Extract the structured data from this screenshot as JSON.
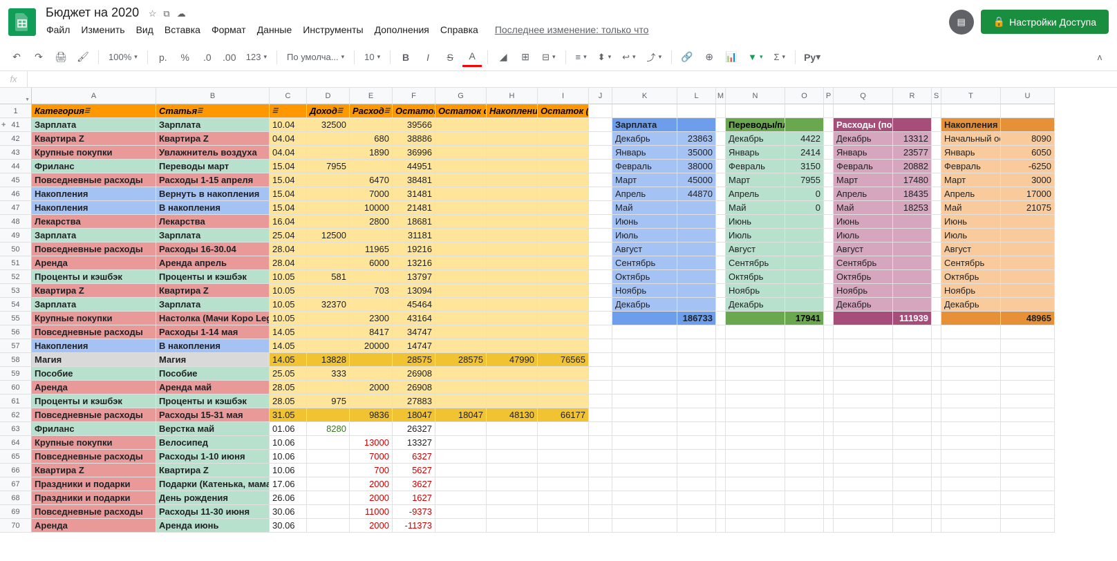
{
  "doc": {
    "title": "Бюджет на 2020"
  },
  "menus": {
    "file": "Файл",
    "edit": "Изменить",
    "view": "Вид",
    "insert": "Вставка",
    "format": "Формат",
    "data": "Данные",
    "tools": "Инструменты",
    "addons": "Дополнения",
    "help": "Справка",
    "lastedit": "Последнее изменение: только что"
  },
  "share": "Настройки Доступа",
  "toolbar": {
    "zoom": "100%",
    "currency": "р.",
    "percent": "%",
    "dec0": ".0",
    "dec00": ".00",
    "num": "123",
    "font": "По умолча...",
    "size": "10"
  },
  "cols": [
    "A",
    "B",
    "C",
    "D",
    "E",
    "F",
    "G",
    "H",
    "I",
    "J",
    "K",
    "L",
    "M",
    "N",
    "O",
    "P",
    "Q",
    "R",
    "S",
    "T",
    "U"
  ],
  "headers": {
    "A": "Категория",
    "B": "Статья",
    "C": "",
    "D": "Доход",
    "E": "Расход",
    "F": "Остаток",
    "G": "Остаток ф",
    "H": "Накоплени",
    "I": "Остаток (ф"
  },
  "rows": [
    {
      "n": "41",
      "A": "Зарплата",
      "B": "Зарплата",
      "C": "10.04",
      "D": "32500",
      "E": "",
      "F": "39566",
      "cA": "c-green",
      "cB": "c-green",
      "cC": "c-yellow",
      "cD": "c-yellow",
      "cE": "c-yellow",
      "cF": "c-yellow",
      "bold": true,
      "coll": true
    },
    {
      "n": "42",
      "A": "Квартира Z",
      "B": "Квартира Z",
      "C": "04.04",
      "D": "",
      "E": "680",
      "F": "38886",
      "cA": "c-red",
      "cB": "c-red",
      "cC": "c-yellow",
      "cD": "c-yellow",
      "cE": "c-yellow",
      "cF": "c-yellow",
      "bold": true
    },
    {
      "n": "43",
      "A": "Крупные покупки",
      "B": "Увлажнитель воздуха",
      "C": "04.04",
      "D": "",
      "E": "1890",
      "F": "36996",
      "cA": "c-red",
      "cB": "c-red",
      "cC": "c-yellow",
      "cD": "c-yellow",
      "cE": "c-yellow",
      "cF": "c-yellow",
      "bold": true
    },
    {
      "n": "44",
      "A": "Фриланс",
      "B": "Переводы март",
      "C": "15.04",
      "D": "7955",
      "E": "",
      "F": "44951",
      "cA": "c-green",
      "cB": "c-green",
      "cC": "c-yellow",
      "cD": "c-yellow",
      "cE": "c-yellow",
      "cF": "c-yellow",
      "bold": true
    },
    {
      "n": "45",
      "A": "Повседневные расходы",
      "B": "Расходы 1-15 апреля",
      "C": "15.04",
      "D": "",
      "E": "6470",
      "F": "38481",
      "cA": "c-red",
      "cB": "c-red",
      "cC": "c-yellow",
      "cD": "c-yellow",
      "cE": "c-yellow",
      "cF": "c-yellow",
      "bold": true
    },
    {
      "n": "46",
      "A": "Накопления",
      "B": "Вернуть в накопления",
      "C": "15.04",
      "D": "",
      "E": "7000",
      "F": "31481",
      "cA": "c-blue",
      "cB": "c-blue",
      "cC": "c-yellow",
      "cD": "c-yellow",
      "cE": "c-yellow",
      "cF": "c-yellow",
      "bold": true
    },
    {
      "n": "47",
      "A": "Накопления",
      "B": "В накопления",
      "C": "15.04",
      "D": "",
      "E": "10000",
      "F": "21481",
      "cA": "c-blue",
      "cB": "c-blue",
      "cC": "c-yellow",
      "cD": "c-yellow",
      "cE": "c-yellow",
      "cF": "c-yellow",
      "bold": true
    },
    {
      "n": "48",
      "A": "Лекарства",
      "B": "Лекарства",
      "C": "16.04",
      "D": "",
      "E": "2800",
      "F": "18681",
      "cA": "c-red",
      "cB": "c-red",
      "cC": "c-yellow",
      "cD": "c-yellow",
      "cE": "c-yellow",
      "cF": "c-yellow",
      "bold": true
    },
    {
      "n": "49",
      "A": "Зарплата",
      "B": "Зарплата",
      "C": "25.04",
      "D": "12500",
      "E": "",
      "F": "31181",
      "cA": "c-green",
      "cB": "c-green",
      "cC": "c-yellow",
      "cD": "c-yellow",
      "cE": "c-yellow",
      "cF": "c-yellow",
      "bold": true
    },
    {
      "n": "50",
      "A": "Повседневные расходы",
      "B": "Расходы 16-30.04",
      "C": "28.04",
      "D": "",
      "E": "11965",
      "F": "19216",
      "cA": "c-red",
      "cB": "c-red",
      "cC": "c-yellow",
      "cD": "c-yellow",
      "cE": "c-yellow",
      "cF": "c-yellow",
      "bold": true
    },
    {
      "n": "51",
      "A": "Аренда",
      "B": "Аренда апрель",
      "C": "28.04",
      "D": "",
      "E": "6000",
      "F": "13216",
      "cA": "c-red",
      "cB": "c-red",
      "cC": "c-yellow",
      "cD": "c-yellow",
      "cE": "c-yellow",
      "cF": "c-yellow",
      "bold": true
    },
    {
      "n": "52",
      "A": "Проценты и кэшбэк",
      "B": "Проценты и кэшбэк",
      "C": "10.05",
      "D": "581",
      "E": "",
      "F": "13797",
      "cA": "c-green",
      "cB": "c-green",
      "cC": "c-yellow",
      "cD": "c-yellow",
      "cE": "c-yellow",
      "cF": "c-yellow",
      "bold": true
    },
    {
      "n": "53",
      "A": "Квартира Z",
      "B": "Квартира Z",
      "C": "10.05",
      "D": "",
      "E": "703",
      "F": "13094",
      "cA": "c-red",
      "cB": "c-red",
      "cC": "c-yellow",
      "cD": "c-yellow",
      "cE": "c-yellow",
      "cF": "c-yellow",
      "bold": true
    },
    {
      "n": "54",
      "A": "Зарплата",
      "B": "Зарплата",
      "C": "10.05",
      "D": "32370",
      "E": "",
      "F": "45464",
      "cA": "c-green",
      "cB": "c-green",
      "cC": "c-yellow",
      "cD": "c-yellow",
      "cE": "c-yellow",
      "cF": "c-yellow",
      "bold": true
    },
    {
      "n": "55",
      "A": "Крупные покупки",
      "B": "Настолка (Мачи Коро Leg)",
      "C": "10.05",
      "D": "",
      "E": "2300",
      "F": "43164",
      "cA": "c-red",
      "cB": "c-red",
      "cC": "c-yellow",
      "cD": "c-yellow",
      "cE": "c-yellow",
      "cF": "c-yellow",
      "bold": true
    },
    {
      "n": "56",
      "A": "Повседневные расходы",
      "B": "Расходы 1-14 мая",
      "C": "14.05",
      "D": "",
      "E": "8417",
      "F": "34747",
      "cA": "c-red",
      "cB": "c-red",
      "cC": "c-yellow",
      "cD": "c-yellow",
      "cE": "c-yellow",
      "cF": "c-yellow",
      "bold": true
    },
    {
      "n": "57",
      "A": "Накопления",
      "B": "В накопления",
      "C": "14.05",
      "D": "",
      "E": "20000",
      "F": "14747",
      "cA": "c-blue",
      "cB": "c-blue",
      "cC": "c-yellow",
      "cD": "c-yellow",
      "cE": "c-yellow",
      "cF": "c-yellow",
      "bold": true
    },
    {
      "n": "58",
      "A": "Магия",
      "B": "Магия",
      "C": "14.05",
      "D": "13828",
      "E": "",
      "F": "28575",
      "G": "28575",
      "H": "47990",
      "I": "76565",
      "cA": "c-gray",
      "cB": "c-gray",
      "cC": "c-yellowd",
      "cD": "c-yellowd",
      "cE": "c-yellowd",
      "cF": "c-yellowd",
      "cG": "c-yellowd",
      "cH": "c-yellowd",
      "cI": "c-yellowd",
      "bold": true
    },
    {
      "n": "59",
      "A": "Пособие",
      "B": "Пособие",
      "C": "25.05",
      "D": "333",
      "E": "",
      "F": "26908",
      "cA": "c-green",
      "cB": "c-green",
      "cC": "c-yellow",
      "cD": "c-yellow",
      "cE": "c-yellow",
      "cF": "c-yellow",
      "bold": true
    },
    {
      "n": "60",
      "A": "Аренда",
      "B": "Аренда май",
      "C": "28.05",
      "D": "",
      "E": "2000",
      "F": "26908",
      "cA": "c-red",
      "cB": "c-red",
      "cC": "c-yellow",
      "cD": "c-yellow",
      "cE": "c-yellow",
      "cF": "c-yellow",
      "bold": true
    },
    {
      "n": "61",
      "A": "Проценты и кэшбэк",
      "B": "Проценты и кэшбэк",
      "C": "28.05",
      "D": "975",
      "E": "",
      "F": "27883",
      "cA": "c-green",
      "cB": "c-green",
      "cC": "c-yellow",
      "cD": "c-yellow",
      "cE": "c-yellow",
      "cF": "c-yellow",
      "bold": true
    },
    {
      "n": "62",
      "A": "Повседневные расходы",
      "B": "Расходы 15-31 мая",
      "C": "31.05",
      "D": "",
      "E": "9836",
      "F": "18047",
      "G": "18047",
      "H": "48130",
      "I": "66177",
      "cA": "c-red",
      "cB": "c-red",
      "cC": "c-yellowd",
      "cD": "c-yellowd",
      "cE": "c-yellowd",
      "cF": "c-yellowd",
      "cG": "c-yellowd",
      "cH": "c-yellowd",
      "cI": "c-yellowd",
      "bold": true
    },
    {
      "n": "63",
      "A": "Фриланс",
      "B": "Верстка май",
      "C": "01.06",
      "D": "8280",
      "E": "",
      "F": "26327",
      "cA": "c-green",
      "cB": "c-green",
      "bold": true
    },
    {
      "n": "64",
      "A": "Крупные покупки",
      "B": "Велосипед",
      "C": "10.06",
      "D": "",
      "E": "13000",
      "F": "13327",
      "cA": "c-red",
      "cB": "c-green",
      "bold": true,
      "redE": true
    },
    {
      "n": "65",
      "A": "Повседневные расходы",
      "B": "Расходы 1-10 июня",
      "C": "10.06",
      "D": "",
      "E": "7000",
      "F": "6327",
      "cA": "c-red",
      "cB": "c-green",
      "bold": true,
      "redE": true,
      "redF": true
    },
    {
      "n": "66",
      "A": "Квартира Z",
      "B": "Квартира Z",
      "C": "10.06",
      "D": "",
      "E": "700",
      "F": "5627",
      "cA": "c-red",
      "cB": "c-green",
      "bold": true,
      "redE": true,
      "redF": true
    },
    {
      "n": "67",
      "A": "Праздники и подарки",
      "B": "Подарки (Катенька, мама)",
      "C": "17.06",
      "D": "",
      "E": "2000",
      "F": "3627",
      "cA": "c-red",
      "cB": "c-green",
      "bold": true,
      "redE": true,
      "redF": true
    },
    {
      "n": "68",
      "A": "Праздники и подарки",
      "B": "День рождения",
      "C": "26.06",
      "D": "",
      "E": "2000",
      "F": "1627",
      "cA": "c-red",
      "cB": "c-green",
      "bold": true,
      "redE": true,
      "redF": true
    },
    {
      "n": "69",
      "A": "Повседневные расходы",
      "B": "Расходы 11-30 июня",
      "C": "30.06",
      "D": "",
      "E": "11000",
      "F": "-9373",
      "cA": "c-red",
      "cB": "c-green",
      "bold": true,
      "redE": true,
      "redF": true
    },
    {
      "n": "70",
      "A": "Аренда",
      "B": "Аренда июнь",
      "C": "30.06",
      "D": "",
      "E": "2000",
      "F": "-11373",
      "cA": "c-red",
      "cB": "c-green",
      "bold": true,
      "redE": true,
      "redF": true
    }
  ],
  "summary": {
    "salary": {
      "title": "Зарплата",
      "months": [
        "Декабрь",
        "Январь",
        "Февраль",
        "Март",
        "Апрель",
        "Май",
        "Июнь",
        "Июль",
        "Август",
        "Сентябрь",
        "Октябрь",
        "Ноябрь",
        "Декабрь"
      ],
      "vals": [
        "23863",
        "35000",
        "38000",
        "45000",
        "44870",
        "",
        "",
        "",
        "",
        "",
        "",
        "",
        ""
      ],
      "total": "186733",
      "hc": "c-blued",
      "rc": "c-blue"
    },
    "transfers": {
      "title": "Переводы/план",
      "vals": [
        "4422",
        "2414",
        "3150",
        "7955",
        "0",
        "0",
        "",
        "",
        "",
        "",
        "",
        "",
        ""
      ],
      "total": "17941",
      "hc": "c-greend",
      "rc": "c-green"
    },
    "expenses": {
      "title": "Расходы (повс)",
      "vals": [
        "13312",
        "23577",
        "20882",
        "17480",
        "18435",
        "18253",
        "",
        "",
        "",
        "",
        "",
        "",
        ""
      ],
      "total": "111939",
      "hc": "c-purpled",
      "rc": "c-purple"
    },
    "savings": {
      "title": "Накопления",
      "first": "Начальный ост",
      "vals": [
        "8090",
        "6050",
        "-6250",
        "3000",
        "17000",
        "21075",
        "",
        "",
        "",
        "",
        "",
        "",
        ""
      ],
      "months": [
        "Январь",
        "Февраль",
        "Март",
        "Апрель",
        "Май",
        "Июнь",
        "Июль",
        "Август",
        "Сентябрь",
        "Октябрь",
        "Ноябрь",
        "Декабрь"
      ],
      "total": "48965",
      "hc": "c-oranged",
      "rc": "c-orange"
    }
  }
}
